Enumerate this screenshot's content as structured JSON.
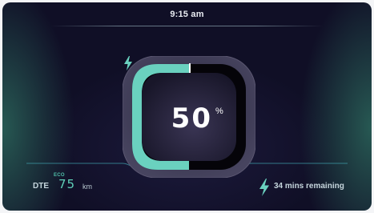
{
  "status_bar": {
    "time": "9:15 am"
  },
  "battery": {
    "percent_value": "50",
    "percent_unit": "%",
    "level_fraction": 0.5,
    "charging_icon": "lightning-bolt-icon"
  },
  "range": {
    "label": "DTE",
    "mode": "ECO",
    "value": "75",
    "unit": "km"
  },
  "charging": {
    "icon": "lightning-bolt-icon",
    "remaining_text": "34 mins remaining"
  },
  "colors": {
    "accent_teal": "#6ad1bf",
    "background": "#0e0d22",
    "text_light": "#e9ecf2"
  }
}
